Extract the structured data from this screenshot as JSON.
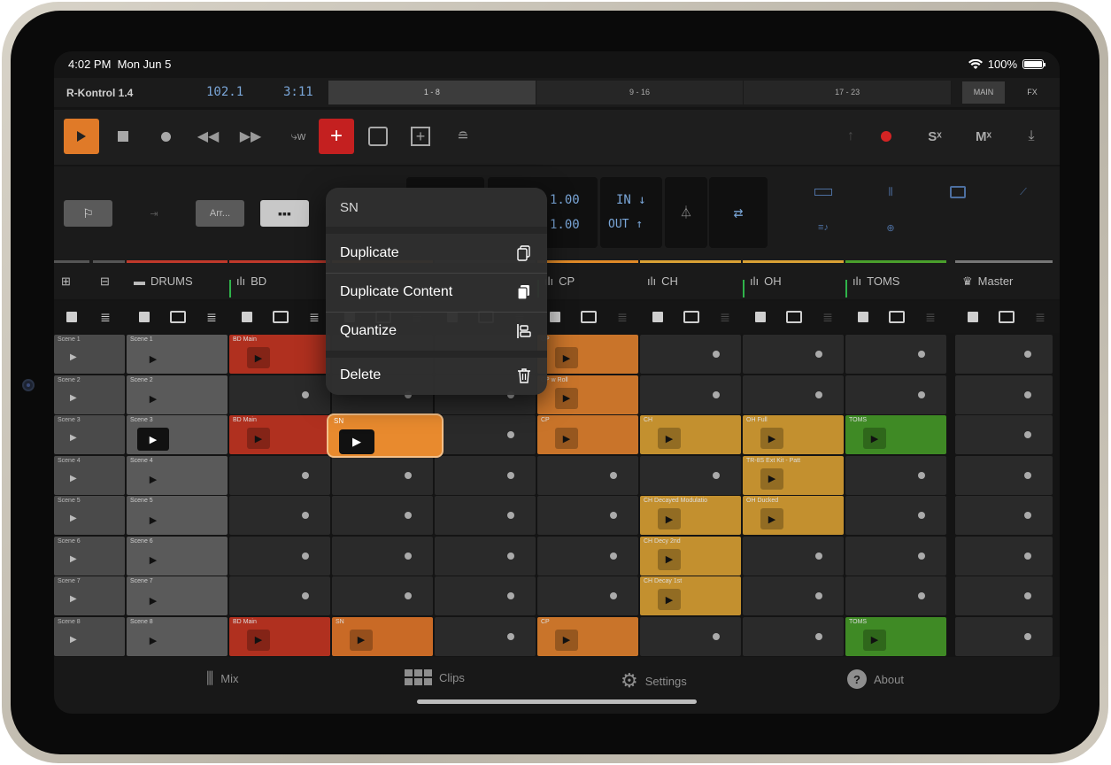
{
  "status": {
    "time": "4:02 PM",
    "date": "Mon Jun 5",
    "battery": "100%"
  },
  "app": {
    "name": "R-Kontrol 1.4",
    "tempo": "102.1",
    "position": "3:11"
  },
  "banks": [
    "1 - 8",
    "9 - 16",
    "17 - 23"
  ],
  "modes": [
    "MAIN",
    "FX"
  ],
  "controls": {
    "arr_label": "Arr...",
    "display_val1": "1.00",
    "display_val2": "1.00",
    "in_label": "IN",
    "out_label": "OUT"
  },
  "tracks": [
    {
      "name": "DRUMS",
      "color": "#c0392b"
    },
    {
      "name": "BD",
      "color": "#c0392b"
    },
    {
      "name": "SN",
      "color": "#e07a28"
    },
    {
      "name": "",
      "color": "#555555"
    },
    {
      "name": "CP",
      "color": "#e08a28"
    },
    {
      "name": "CH",
      "color": "#d9a135"
    },
    {
      "name": "OH",
      "color": "#d9a135"
    },
    {
      "name": "TOMS",
      "color": "#4aa02c"
    },
    {
      "name": "Master",
      "color": "#777777"
    }
  ],
  "scenes": [
    "Scene 1",
    "Scene 2",
    "Scene 3",
    "Scene 4",
    "Scene 5",
    "Scene 6",
    "Scene 7",
    "Scene 8"
  ],
  "clips": {
    "bd": [
      "BD Main",
      "",
      "BD Main",
      "",
      "",
      "",
      "",
      "BD Main"
    ],
    "sn": [
      "",
      "",
      "SN",
      "",
      "",
      "",
      "",
      "SN"
    ],
    "cp": [
      "CP",
      "CP w Roll",
      "CP",
      "",
      "",
      "",
      "",
      "CP"
    ],
    "ch": [
      "",
      "",
      "CH",
      "",
      "CH Decayed Modulatio",
      "CH Decy 2nd",
      "CH Decay 1st",
      ""
    ],
    "oh": [
      "",
      "",
      "OH Full",
      "TR-8S Ext Kit - Patt",
      "OH Ducked",
      "",
      "",
      ""
    ],
    "toms": [
      "",
      "",
      "TOMS",
      "",
      "",
      "",
      "",
      "TOMS"
    ]
  },
  "popup": {
    "title": "SN",
    "items": [
      "Duplicate",
      "Duplicate Content",
      "Quantize",
      "Delete"
    ]
  },
  "tabs": [
    "Mix",
    "Clips",
    "Settings",
    "About"
  ],
  "colors": {
    "accent": "#e07a28",
    "record": "#d42424",
    "meter": "#2fb34a"
  }
}
